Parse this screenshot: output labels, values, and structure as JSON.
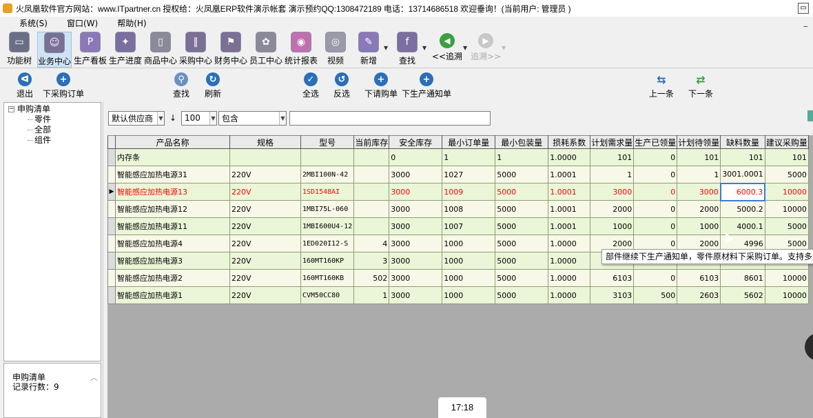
{
  "titlebar": {
    "text": "火凤凰软件官方网站：www.ITpartner.cn  授权给：火凤凰ERP软件演示帐套  演示预约QQ:1308472189  电话：13714686518  欢迎垂询！(当前用户: 管理员 )"
  },
  "menu": {
    "items": [
      "系统(S)",
      "窗口(W)",
      "帮助(H)"
    ]
  },
  "toolbar1": {
    "items": [
      {
        "label": "功能树",
        "icon": "monitor-icon",
        "color": "#6b6f86"
      },
      {
        "label": "业务中心",
        "icon": "chat-icon",
        "color": "#7a6f95"
      },
      {
        "label": "生产看板",
        "icon": "p-letter-icon",
        "color": "#8a78b8"
      },
      {
        "label": "生产进度",
        "icon": "sparkle-icon",
        "color": "#7a6fa0"
      },
      {
        "label": "商品中心",
        "icon": "phone-icon",
        "color": "#8a8a98"
      },
      {
        "label": "采购中心",
        "icon": "chart-icon",
        "color": "#7a6f95"
      },
      {
        "label": "财务中心",
        "icon": "flag-icon",
        "color": "#7a6f95"
      },
      {
        "label": "员工中心",
        "icon": "people-icon",
        "color": "#8a8a98"
      },
      {
        "label": "统计报表",
        "icon": "report-icon",
        "color": "#c070b0"
      },
      {
        "label": "视频",
        "icon": "video-icon",
        "color": "#9a9aa8"
      },
      {
        "label": "新增",
        "icon": "add-icon",
        "color": "#8a78b8"
      },
      {
        "label": "查找",
        "icon": "find-icon",
        "color": "#7a6fa0"
      },
      {
        "label": "<<追溯",
        "icon": "back-arrow-icon",
        "color": "#3aa040"
      },
      {
        "label": "追溯>>",
        "icon": "forward-arrow-icon",
        "color": "#bbbbbb"
      }
    ]
  },
  "toolbar2": {
    "exit": "退出",
    "purchase_order": "下采购订单",
    "search": "查找",
    "refresh": "刷新",
    "select_all": "全选",
    "invert": "反选",
    "request_order": "下请购单",
    "production_notice": "下生产通知单",
    "prev": "上一条",
    "next": "下一条"
  },
  "tree": {
    "root": "申购清单",
    "children": [
      "零件",
      "全部",
      "组件"
    ]
  },
  "leftinfo": {
    "title": "申购清单",
    "count_label": "记录行数：9"
  },
  "filter": {
    "supplier": "默认供应商",
    "sort_icon": "↓",
    "count": "100",
    "mode": "包含",
    "text": ""
  },
  "grid": {
    "headers": [
      "产品名称",
      "规格",
      "型号",
      "当前库存",
      "安全库存",
      "最小订单量",
      "最小包装量",
      "损耗系数",
      "计划需求量",
      "生产已领量",
      "计划待领量",
      "缺料数量",
      "建议采购量"
    ],
    "rows": [
      {
        "name": "内存条",
        "spec": "",
        "model": "",
        "stock": "",
        "safe": "0",
        "minorder": "1",
        "minpack": "1",
        "loss": "1.0000",
        "plan": "101",
        "taken": "0",
        "pending": "101",
        "short": "101",
        "suggest": "101"
      },
      {
        "name": "智能感应加热电源31",
        "spec": "220V",
        "model": "2MBI100N-42",
        "stock": "",
        "safe": "3000",
        "minorder": "1027",
        "minpack": "5000",
        "loss": "1.0001",
        "plan": "1",
        "taken": "0",
        "pending": "1",
        "short": "3001.0001",
        "suggest": "5000"
      },
      {
        "name": "智能感应加热电源13",
        "spec": "220V",
        "model": "1SD1548AI",
        "stock": "",
        "safe": "3000",
        "minorder": "1009",
        "minpack": "5000",
        "loss": "1.0001",
        "plan": "3000",
        "taken": "0",
        "pending": "3000",
        "short": "6000.3",
        "suggest": "10000"
      },
      {
        "name": "智能感应加热电源12",
        "spec": "220V",
        "model": "1MBI75L-060",
        "stock": "",
        "safe": "3000",
        "minorder": "1008",
        "minpack": "5000",
        "loss": "1.0001",
        "plan": "2000",
        "taken": "0",
        "pending": "2000",
        "short": "5000.2",
        "suggest": "10000"
      },
      {
        "name": "智能感应加热电源11",
        "spec": "220V",
        "model": "1MBI600U4-12",
        "stock": "",
        "safe": "3000",
        "minorder": "1007",
        "minpack": "5000",
        "loss": "1.0001",
        "plan": "1000",
        "taken": "0",
        "pending": "1000",
        "short": "4000.1",
        "suggest": "5000"
      },
      {
        "name": "智能感应加热电源4",
        "spec": "220V",
        "model": "1ED020I12-S",
        "stock": "4",
        "safe": "3000",
        "minorder": "1000",
        "minpack": "5000",
        "loss": "1.0000",
        "plan": "2000",
        "taken": "0",
        "pending": "2000",
        "short": "4996",
        "suggest": "5000"
      },
      {
        "name": "智能感应加热电源3",
        "spec": "220V",
        "model": "160MT160KP",
        "stock": "3",
        "safe": "3000",
        "minorder": "1000",
        "minpack": "5000",
        "loss": "1.0000",
        "plan": "",
        "taken": "",
        "pending": "",
        "short": "",
        "suggest": ""
      },
      {
        "name": "智能感应加热电源2",
        "spec": "220V",
        "model": "160MT160KB",
        "stock": "502",
        "safe": "3000",
        "minorder": "1000",
        "minpack": "5000",
        "loss": "1.0000",
        "plan": "6103",
        "taken": "0",
        "pending": "6103",
        "short": "8601",
        "suggest": "10000"
      },
      {
        "name": "智能感应加热电源1",
        "spec": "220V",
        "model": "CVM50CC80",
        "stock": "1",
        "safe": "3000",
        "minorder": "1000",
        "minpack": "5000",
        "loss": "1.0000",
        "plan": "3103",
        "taken": "500",
        "pending": "2603",
        "short": "5602",
        "suggest": "10000"
      }
    ]
  },
  "tooltip": "部件继续下生产通知单，零件原材料下采购订单。支持多选后",
  "clock": "17:18"
}
